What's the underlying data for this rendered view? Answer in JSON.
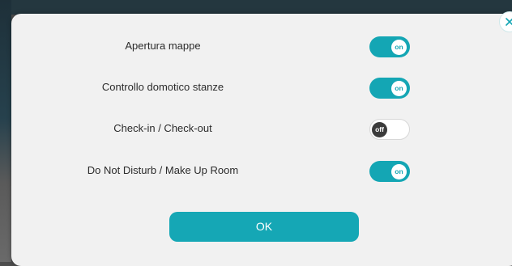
{
  "settings": [
    {
      "label": "Apertura mappe",
      "state": "on",
      "enabled": true
    },
    {
      "label": "Controllo domotico stanze",
      "state": "on",
      "enabled": true
    },
    {
      "label": "Check-in / Check-out",
      "state": "off",
      "enabled": false
    },
    {
      "label": "Do Not Disturb / Make Up Room",
      "state": "on",
      "enabled": true
    }
  ],
  "ok_label": "OK",
  "colors": {
    "accent": "#14a6b4",
    "modal_bg": "#f1f1f1",
    "knob_off": "#3b3b3b"
  },
  "icons": {
    "close": "close-icon"
  }
}
